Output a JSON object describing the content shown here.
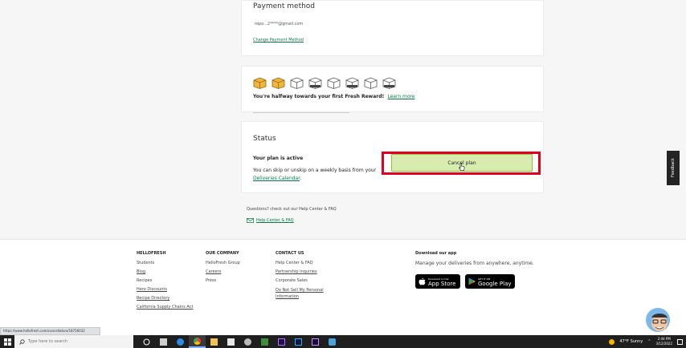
{
  "payment": {
    "title": "Payment method",
    "email": "repo...2****@gmail.com",
    "change_link": "Change Payment Method"
  },
  "rewards": {
    "box_icons": [
      "box-filled",
      "box-filled",
      "box-empty",
      "box-reward",
      "box-empty",
      "box-reward",
      "box-empty",
      "box-reward"
    ],
    "message": "You're halfway towards your first Fresh Reward!",
    "learn_more": "Learn more"
  },
  "status": {
    "title": "Status",
    "plan_active": "Your plan is active",
    "desc_prefix": "You can skip or unskip on a weekly basis from your",
    "calendar_link": "Deliveries Calendar",
    "desc_suffix": ".",
    "cancel_label": "Cancel plan"
  },
  "help": {
    "question": "Questions? check out our Help Center & FAQ",
    "link": "Help Center & FAQ"
  },
  "feedback_label": "Feedback",
  "footer": {
    "hellofresh": {
      "heading": "HELLOFRESH",
      "items": [
        "Students",
        "Blog",
        "Recipes",
        "Hero Discounts",
        "Recipe Directory",
        "California Supply Chains Act"
      ]
    },
    "company": {
      "heading": "OUR COMPANY",
      "items": [
        "HelloFresh Group",
        "Careers",
        "Press"
      ]
    },
    "contact": {
      "heading": "CONTACT US",
      "items": [
        "Help Center & FAQ",
        "Partnership Inquiries",
        "Corporate Sales",
        "Do Not Sell My Personal Information"
      ]
    },
    "app": {
      "heading": "Download our app",
      "desc": "Manage your deliveries from anywhere, anytime.",
      "appstore_small": "Download on the",
      "appstore_big": "App Store",
      "googleplay_small": "GET IT ON",
      "googleplay_big": "Google Play"
    }
  },
  "status_url": "https://www.hellofresh.com/cancellation/18756032",
  "taskbar": {
    "search_placeholder": "Type here to search",
    "weather": "47°F Sunny",
    "time": "2:44 PM",
    "date": "3/12/2022"
  },
  "colors": {
    "accent_green": "#067a46",
    "button_bg": "#d8ecaf",
    "highlight_red": "#e3001b"
  }
}
